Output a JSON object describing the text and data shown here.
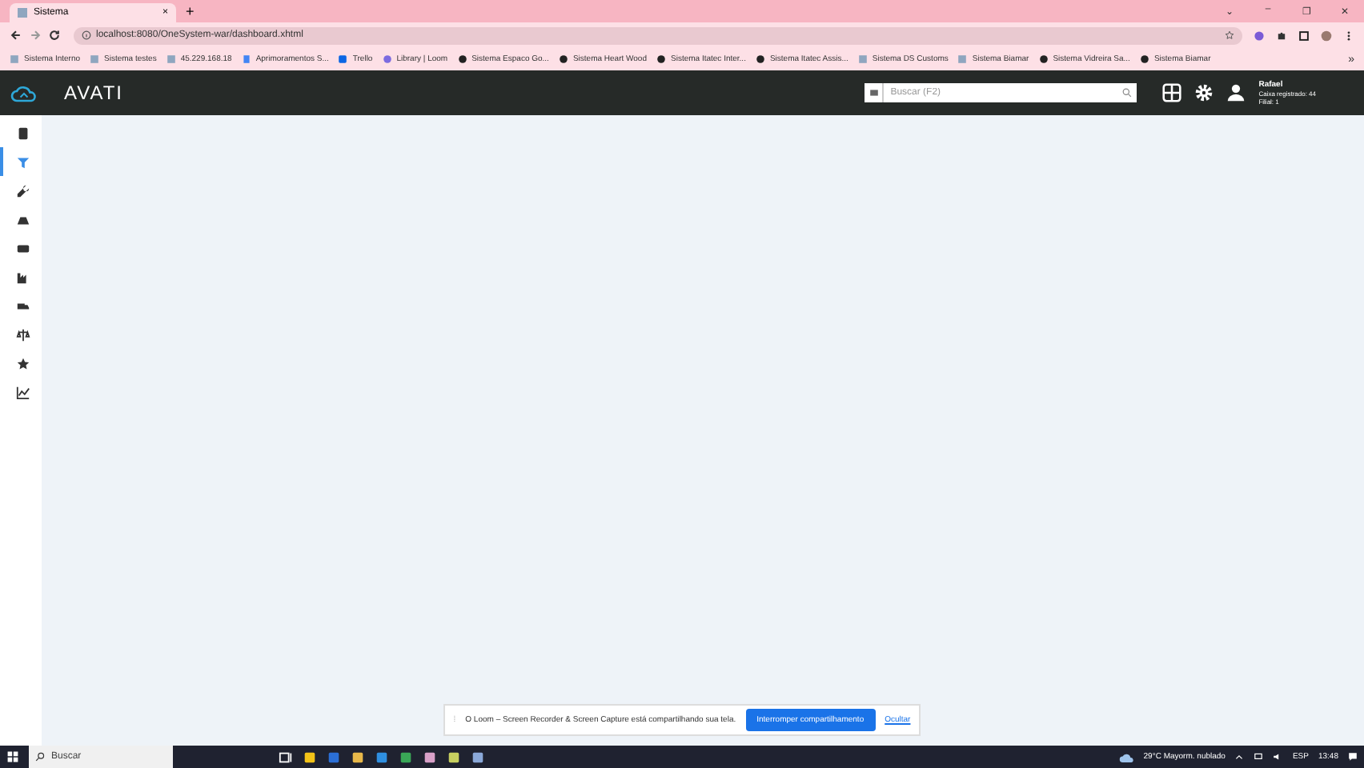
{
  "browser": {
    "tab": {
      "title": "Sistema",
      "close": "×"
    },
    "new_tab": "+",
    "window_controls": [
      "⌄",
      "–",
      "❐",
      "✕"
    ],
    "url": "localhost:8080/OneSystem-war/dashboard.xhtml",
    "bookmarks": [
      {
        "label": "Sistema Interno",
        "kind": "page"
      },
      {
        "label": "Sistema testes",
        "kind": "page"
      },
      {
        "label": "45.229.168.18",
        "kind": "page"
      },
      {
        "label": "Aprimoramentos S...",
        "kind": "doc"
      },
      {
        "label": "Trello",
        "kind": "trello"
      },
      {
        "label": "Library | Loom",
        "kind": "loom"
      },
      {
        "label": "Sistema Espaco Go...",
        "kind": "globe"
      },
      {
        "label": "Sistema Heart Wood",
        "kind": "globe"
      },
      {
        "label": "Sistema Itatec Inter...",
        "kind": "globe"
      },
      {
        "label": "Sistema Itatec Assis...",
        "kind": "globe"
      },
      {
        "label": "Sistema DS Customs",
        "kind": "page"
      },
      {
        "label": "Sistema Biamar",
        "kind": "page"
      },
      {
        "label": "Sistema Vidreira Sa...",
        "kind": "globe"
      },
      {
        "label": "Sistema Biamar",
        "kind": "globe"
      }
    ],
    "more": "»"
  },
  "app": {
    "brand": "AVATI",
    "search": {
      "placeholder": "Buscar (F2)"
    },
    "user": {
      "name": "Rafael",
      "line_1": "Caixa registrado: 44",
      "line_2": "Filial: 1"
    }
  },
  "sidebar": {
    "items": [
      {
        "selected": false
      },
      {
        "selected": true
      },
      {
        "selected": false
      },
      {
        "selected": false
      },
      {
        "selected": false
      },
      {
        "selected": false
      },
      {
        "selected": false
      },
      {
        "selected": false
      },
      {
        "selected": false
      },
      {
        "selected": false
      }
    ]
  },
  "share_bar": {
    "handle": "⁞",
    "message": "O Loom – Screen Recorder & Screen Capture está compartilhando sua tela.",
    "stop_button": "Interromper compartilhamento",
    "hide_link": "Ocultar"
  },
  "taskbar": {
    "search": "Buscar",
    "weather": "29°C  Mayorm. nublado",
    "language": "ESP",
    "time": "13:48"
  }
}
